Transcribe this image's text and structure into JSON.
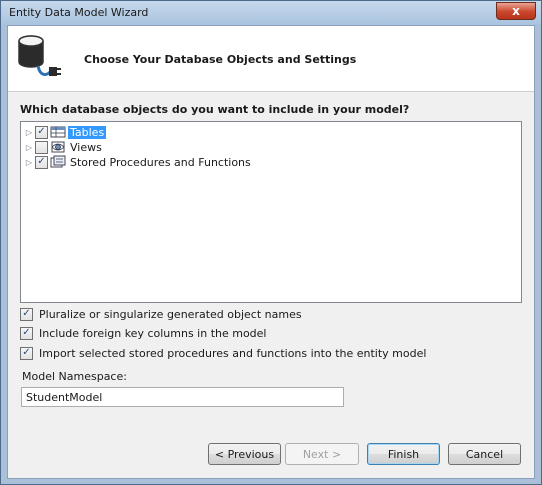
{
  "window": {
    "title": "Entity Data Model Wizard",
    "close_glyph": "x"
  },
  "header": {
    "title": "Choose Your Database Objects and Settings",
    "icon": "database-plug-icon"
  },
  "objects": {
    "question": "Which database objects do you want to include in your model?",
    "nodes": [
      {
        "label": "Tables",
        "checked": true,
        "selected": true,
        "icon": "table-icon"
      },
      {
        "label": "Views",
        "checked": false,
        "selected": false,
        "icon": "view-icon"
      },
      {
        "label": "Stored Procedures and Functions",
        "checked": true,
        "selected": false,
        "icon": "procedure-icon"
      }
    ]
  },
  "options": [
    {
      "label": "Pluralize or singularize generated object names",
      "checked": true
    },
    {
      "label": "Include foreign key columns in the model",
      "checked": true
    },
    {
      "label": "Import selected stored procedures and functions into the entity model",
      "checked": true
    }
  ],
  "namespace": {
    "label": "Model Namespace:",
    "value": "StudentModel"
  },
  "buttons": {
    "previous": "< Previous",
    "next": "Next >",
    "finish": "Finish",
    "cancel": "Cancel"
  },
  "glyphs": {
    "check": "✓",
    "expand": "▷"
  }
}
